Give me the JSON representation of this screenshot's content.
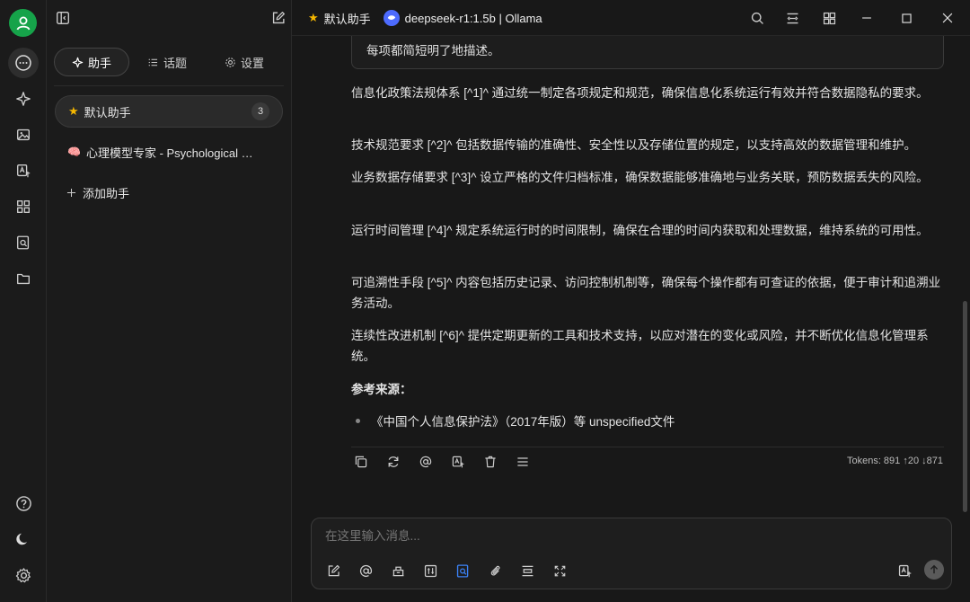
{
  "topbar": {
    "assistant_name": "默认助手",
    "model_name": "deepseek-r1:1.5b | Ollama"
  },
  "sidebar": {
    "tabs": [
      {
        "label": "助手"
      },
      {
        "label": "话题"
      },
      {
        "label": "设置"
      }
    ],
    "assistants": [
      {
        "icon": "★",
        "label": "默认助手",
        "count": "3"
      },
      {
        "icon": "🧠",
        "label": "心理模型专家 - Psychological Models Expert"
      }
    ],
    "add_label": "添加助手"
  },
  "chat": {
    "prev_text": "每项都简短明了地描述。",
    "paragraphs": [
      "信息化政策法规体系 [^1]^ 通过统一制定各项规定和规范，确保信息化系统运行有效并符合数据隐私的要求。",
      "技术规范要求 [^2]^ 包括数据传输的准确性、安全性以及存储位置的规定，以支持高效的数据管理和维护。",
      "业务数据存储要求 [^3]^ 设立严格的文件归档标准，确保数据能够准确地与业务关联，预防数据丢失的风险。",
      "运行时间管理 [^4]^ 规定系统运行时的时间限制，确保在合理的时间内获取和处理数据，维持系统的可用性。",
      "可追溯性手段 [^5]^ 内容包括历史记录、访问控制机制等，确保每个操作都有可查证的依据，便于审计和追溯业务活动。",
      "连续性改进机制 [^6]^ 提供定期更新的工具和技术支持，以应对潜在的变化或风险，并不断优化信息化管理系统。"
    ],
    "refs_title": "参考来源：",
    "refs": [
      "《中国个人信息保护法》（2017年版）等 unspecified文件"
    ],
    "tokens": "Tokens: 891 ↑20 ↓871"
  },
  "input": {
    "placeholder": "在这里输入消息..."
  }
}
